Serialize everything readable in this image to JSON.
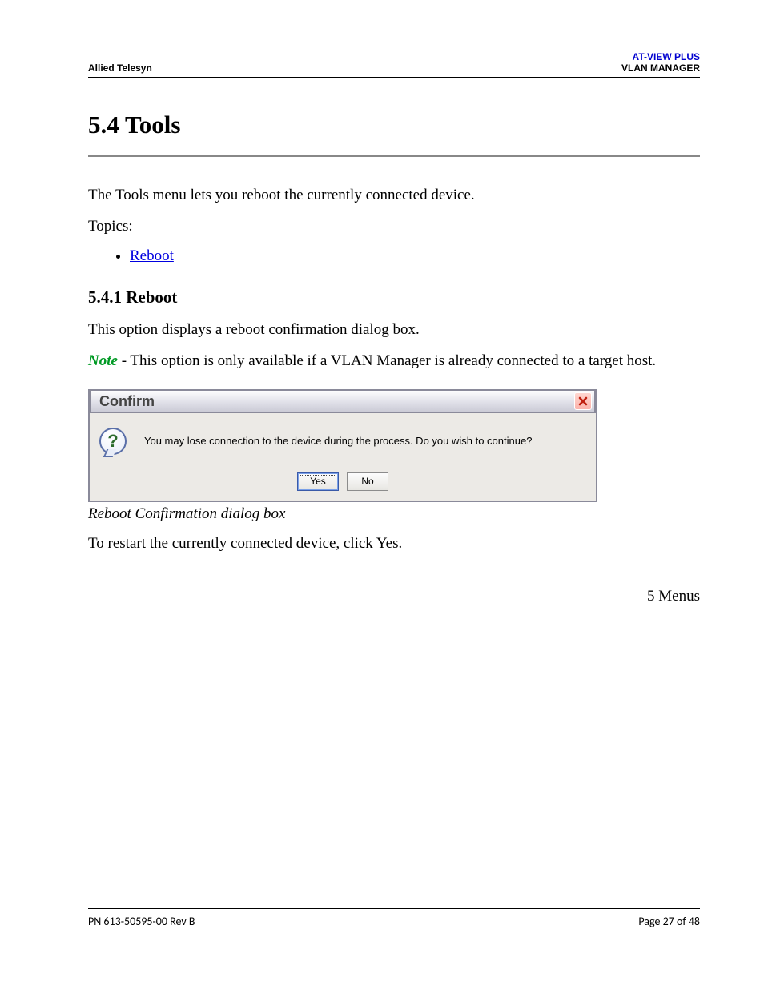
{
  "header": {
    "company": "Allied Telesyn",
    "product": "AT-VIEW PLUS",
    "section": "VLAN MANAGER"
  },
  "title": "5.4 Tools",
  "intro": "The Tools menu lets you reboot the currently connected device.",
  "topics_label": "Topics:",
  "topics": [
    "Reboot"
  ],
  "subsection_title": "5.4.1 Reboot",
  "sub_intro": "This option displays a reboot confirmation dialog box.",
  "note_label": "Note",
  "note_text": " - This option is only available if a VLAN Manager is already connected to a target host.",
  "dialog": {
    "title": "Confirm",
    "icon_glyph": "?",
    "message": "You may lose connection to the device during the process. Do you wish to continue?",
    "yes_label": "Yes",
    "no_label": "No"
  },
  "caption": "Reboot Confirmation dialog box",
  "post_dialog": "To restart the currently connected device, click Yes.",
  "next_section": "5 Menus",
  "footer": {
    "left": "PN 613-50595-00 Rev B",
    "right": "Page 27 of 48"
  }
}
